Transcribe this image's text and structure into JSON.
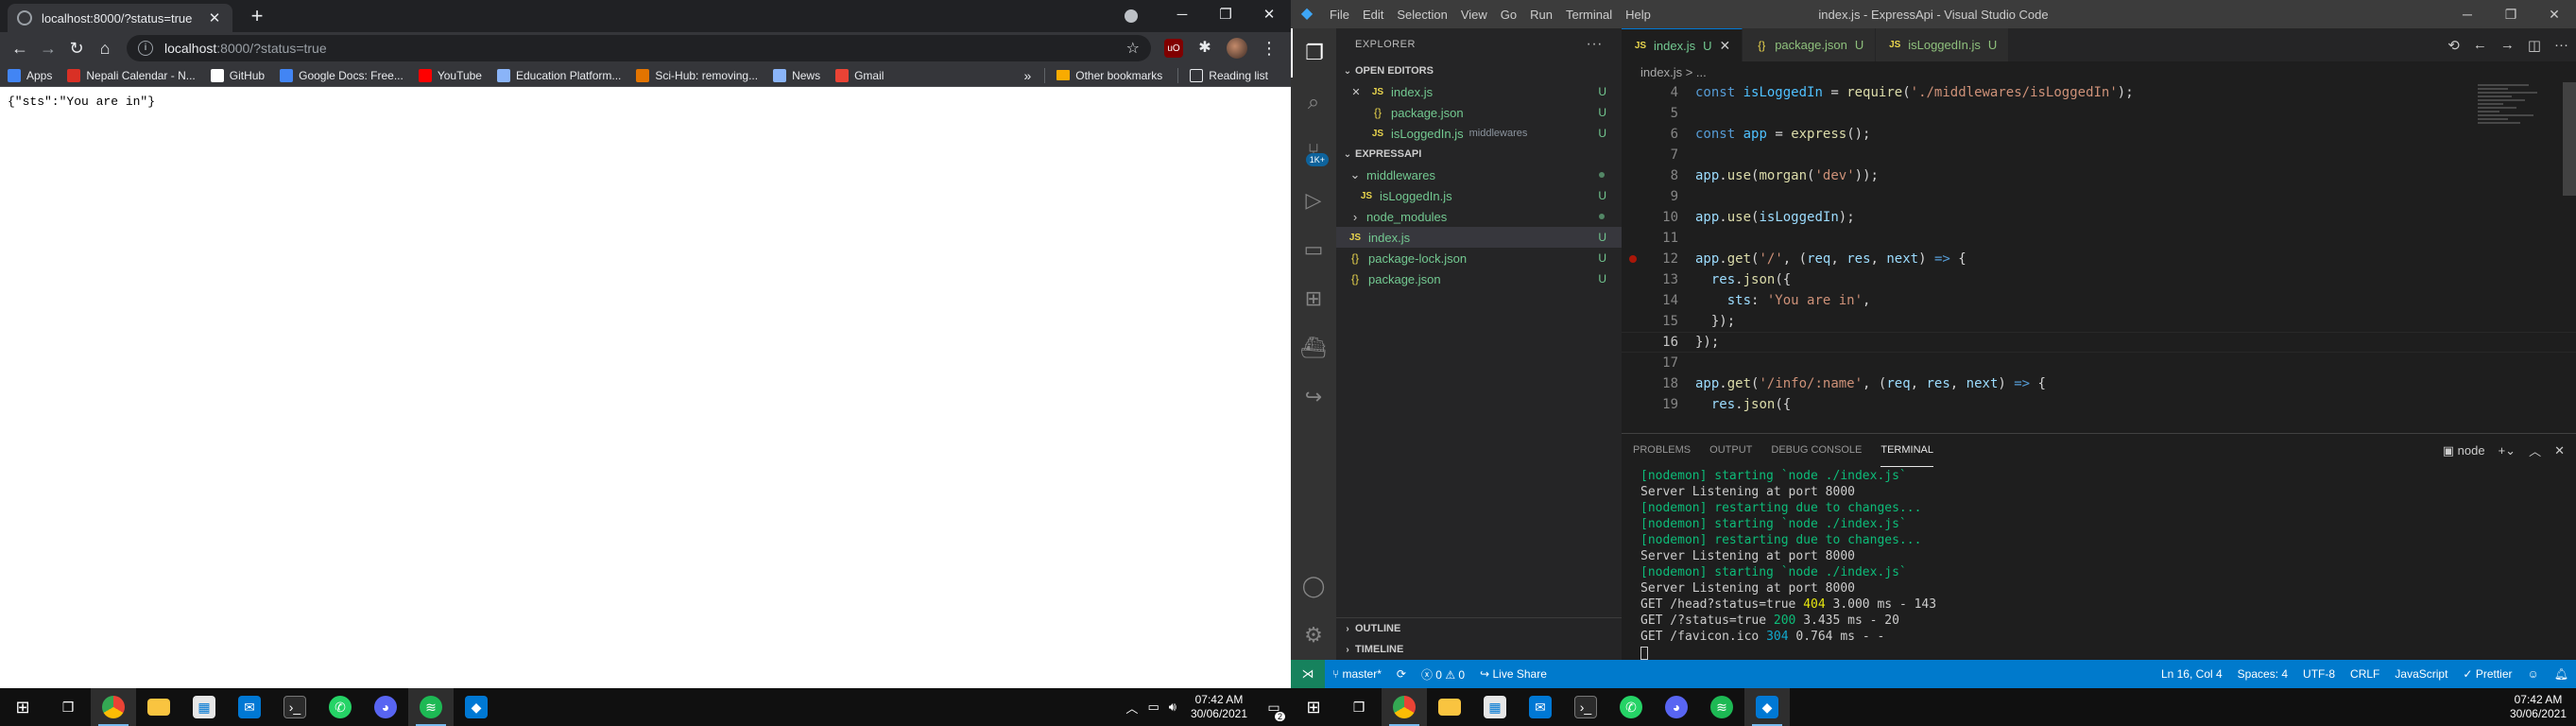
{
  "chrome": {
    "tab_title": "localhost:8000/?status=true",
    "url_host": "localhost",
    "url_path": ":8000/?status=true",
    "bookmarks": [
      {
        "label": "Apps",
        "icon": "apps-grid-icon",
        "color": "#4285f4"
      },
      {
        "label": "Nepali Calendar - N...",
        "icon": "calendar-icon",
        "color": "#d93025"
      },
      {
        "label": "GitHub",
        "icon": "github-icon",
        "color": "#ffffff"
      },
      {
        "label": "Google Docs: Free...",
        "icon": "docs-icon",
        "color": "#4285f4"
      },
      {
        "label": "YouTube",
        "icon": "youtube-icon",
        "color": "#ff0000"
      },
      {
        "label": "Education Platform...",
        "icon": "shield-icon",
        "color": "#8ab4f8"
      },
      {
        "label": "Sci-Hub: removing...",
        "icon": "scihub-icon",
        "color": "#e37400"
      },
      {
        "label": "News",
        "icon": "news-icon",
        "color": "#8ab4f8"
      },
      {
        "label": "Gmail",
        "icon": "gmail-icon",
        "color": "#ea4335"
      }
    ],
    "other_bookmarks": "Other bookmarks",
    "reading_list": "Reading list",
    "page_text": "{\"sts\":\"You are in\"}"
  },
  "vscode": {
    "menu": [
      "File",
      "Edit",
      "Selection",
      "View",
      "Go",
      "Run",
      "Terminal",
      "Help"
    ],
    "window_title": "index.js - ExpressApi - Visual Studio Code",
    "scm_badge": "1K+",
    "explorer": {
      "header": "EXPLORER",
      "open_editors_label": "OPEN EDITORS",
      "open_editors": [
        {
          "name": "index.js",
          "type": "js",
          "status": "U",
          "extra": "",
          "closable": true
        },
        {
          "name": "package.json",
          "type": "json",
          "status": "U",
          "extra": ""
        },
        {
          "name": "isLoggedIn.js",
          "type": "js",
          "status": "U",
          "extra": "middlewares"
        }
      ],
      "project_label": "EXPRESSAPI",
      "tree": [
        {
          "name": "middlewares",
          "kind": "folder-open",
          "indent": 0
        },
        {
          "name": "isLoggedIn.js",
          "kind": "js",
          "indent": 1,
          "status": "U"
        },
        {
          "name": "node_modules",
          "kind": "folder",
          "indent": 0
        },
        {
          "name": "index.js",
          "kind": "js",
          "indent": 0,
          "status": "U",
          "selected": true
        },
        {
          "name": "package-lock.json",
          "kind": "json",
          "indent": 0,
          "status": "U"
        },
        {
          "name": "package.json",
          "kind": "json",
          "indent": 0,
          "status": "U"
        }
      ],
      "outline_label": "OUTLINE",
      "timeline_label": "TIMELINE"
    },
    "tabs": [
      {
        "name": "index.js",
        "type": "js",
        "status": "U",
        "active": true
      },
      {
        "name": "package.json",
        "type": "json",
        "status": "U"
      },
      {
        "name": "isLoggedIn.js",
        "type": "js",
        "status": "U"
      }
    ],
    "breadcrumb": "index.js > ...",
    "code_lines": [
      {
        "n": "4",
        "html": "<span class='k'>const</span> <span class='c'>isLoggedIn</span> = <span class='f'>require</span>(<span class='s'>'./middlewares/isLoggedIn'</span>);"
      },
      {
        "n": "5",
        "html": ""
      },
      {
        "n": "6",
        "html": "<span class='k'>const</span> <span class='c'>app</span> = <span class='f'>express</span>();"
      },
      {
        "n": "7",
        "html": ""
      },
      {
        "n": "8",
        "html": "<span class='v'>app</span>.<span class='f'>use</span>(<span class='f'>morgan</span>(<span class='s'>'dev'</span>));"
      },
      {
        "n": "9",
        "html": ""
      },
      {
        "n": "10",
        "html": "<span class='v'>app</span>.<span class='f'>use</span>(<span class='v'>isLoggedIn</span>);"
      },
      {
        "n": "11",
        "html": ""
      },
      {
        "n": "12",
        "html": "<span class='v'>app</span>.<span class='f'>get</span>(<span class='s'>'/'</span>, (<span class='v'>req</span>, <span class='v'>res</span>, <span class='v'>next</span>) <span class='k'>=&gt;</span> {",
        "bp": true
      },
      {
        "n": "13",
        "html": "  <span class='v'>res</span>.<span class='f'>json</span>({"
      },
      {
        "n": "14",
        "html": "    <span class='v'>sts</span>: <span class='s'>'You are in'</span>,"
      },
      {
        "n": "15",
        "html": "  });"
      },
      {
        "n": "16",
        "html": "});",
        "current": true
      },
      {
        "n": "17",
        "html": ""
      },
      {
        "n": "18",
        "html": "<span class='v'>app</span>.<span class='f'>get</span>(<span class='s'>'/info/:name'</span>, (<span class='v'>req</span>, <span class='v'>res</span>, <span class='v'>next</span>) <span class='k'>=&gt;</span> {"
      },
      {
        "n": "19",
        "html": "  <span class='v'>res</span>.<span class='f'>json</span>({"
      }
    ],
    "panel_tabs": [
      "PROBLEMS",
      "OUTPUT",
      "DEBUG CONSOLE",
      "TERMINAL"
    ],
    "terminal_shell": "node",
    "terminal": [
      {
        "cls": "g",
        "html": "[nodemon] starting `node ./index.js`"
      },
      {
        "cls": "",
        "html": "Server Listening at port 8000"
      },
      {
        "cls": "g",
        "html": "[nodemon] restarting due to changes..."
      },
      {
        "cls": "g",
        "html": "[nodemon] starting `node ./index.js`"
      },
      {
        "cls": "g",
        "html": "[nodemon] restarting due to changes..."
      },
      {
        "cls": "",
        "html": "Server Listening at port 8000"
      },
      {
        "cls": "g",
        "html": "[nodemon] starting `node ./index.js`"
      },
      {
        "cls": "",
        "html": "Server Listening at port 8000"
      },
      {
        "cls": "",
        "html": "GET /head?status=true <span class='yel'>404</span> 3.000 ms - 143"
      },
      {
        "cls": "",
        "html": "GET /?status=true <span class='grn'>200</span> 3.435 ms - 20"
      },
      {
        "cls": "",
        "html": "GET /favicon.ico <span class='cyn'>304</span> 0.764 ms - -"
      }
    ],
    "status": {
      "branch": "master*",
      "errors": "0",
      "warnings": "0",
      "live_share": "Live Share",
      "position": "Ln 16, Col 4",
      "spaces": "Spaces: 4",
      "encoding": "UTF-8",
      "eol": "CRLF",
      "language": "JavaScript",
      "prettier": "Prettier"
    }
  },
  "taskbar": {
    "time": "07:42 AM",
    "date": "30/06/2021",
    "notif_count": "2"
  }
}
